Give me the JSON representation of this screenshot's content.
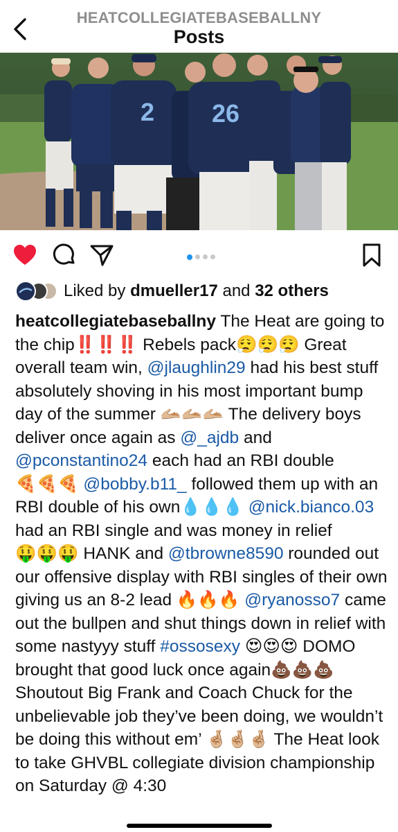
{
  "header": {
    "username": "HEATCOLLEGIATEBASEBALLNY",
    "title": "Posts"
  },
  "photo": {
    "jersey_numbers": [
      "2",
      "26"
    ],
    "colors": {
      "jersey": "#1e2e55",
      "jersey_number": "#8bb8e8",
      "grass": "#6f9a4e",
      "dirt": "#b49a80",
      "trees": "#2f4a2a"
    }
  },
  "carousel": {
    "count": 4,
    "active": 0
  },
  "likes": {
    "prefix": "Liked by",
    "user": "dmueller17",
    "joiner": "and",
    "others": "32 others"
  },
  "caption": {
    "username": "heatcollegiatebaseballny",
    "segments": [
      {
        "t": " The Heat are going to the chip"
      },
      {
        "e": "‼️‼️‼️"
      },
      {
        "t": " Rebels pack"
      },
      {
        "e": "😮‍💨😮‍💨😮‍💨"
      },
      {
        "t": " Great overall team win, "
      },
      {
        "m": "@jlaughlin29"
      },
      {
        "t": " had his best stuff absolutely shoving in his most important bump day of the summer "
      },
      {
        "e": "🫴🏼🫴🏼🫴🏼"
      },
      {
        "t": " The delivery boys deliver once again as "
      },
      {
        "m": "@_ajdb"
      },
      {
        "t": " and "
      },
      {
        "m": "@pconstantino24"
      },
      {
        "t": " each had an RBI double"
      },
      {
        "e": "🍕🍕🍕"
      },
      {
        "t": " "
      },
      {
        "m": "@bobby.b11_"
      },
      {
        "t": " followed them up with an RBI double of his own"
      },
      {
        "e": "💧💧💧"
      },
      {
        "t": " "
      },
      {
        "m": "@nick.bianco.03"
      },
      {
        "t": " had an RBI single and was money in relief "
      },
      {
        "e": "🤑🤑🤑"
      },
      {
        "t": " HANK and "
      },
      {
        "m": "@tbrowne8590"
      },
      {
        "t": " rounded out our offensive display with RBI singles of their own giving us an 8-2 lead "
      },
      {
        "e": "🔥🔥🔥"
      },
      {
        "t": " "
      },
      {
        "m": "@ryanosso7"
      },
      {
        "t": " came out the bullpen and shut things down in relief with some nastyyy stuff "
      },
      {
        "m": "#ossosexy"
      },
      {
        "t": " "
      },
      {
        "e": "😍😍😍"
      },
      {
        "t": " DOMO brought that good luck once again"
      },
      {
        "e": "💩💩💩"
      },
      {
        "t": " Shoutout Big Frank and Coach Chuck for the unbelievable job they’ve been doing, we wouldn’t be doing this without em’ "
      },
      {
        "e": "🤞🏼🤞🏼🤞🏼"
      },
      {
        "t": " The Heat look to take GHVBL collegiate division championship on Saturday @ 4:30"
      }
    ]
  }
}
